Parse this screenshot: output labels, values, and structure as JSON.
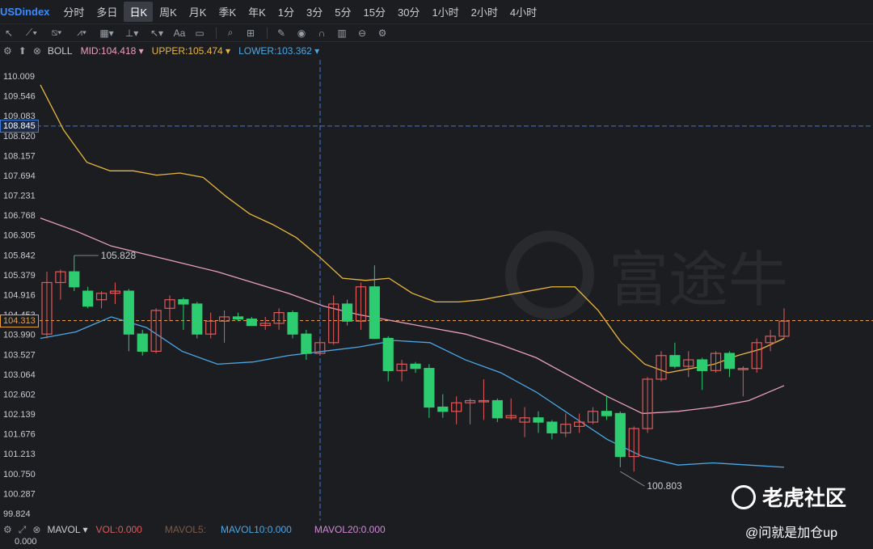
{
  "toolbar": {
    "symbol": "USDindex",
    "timeframes": [
      "分时",
      "多日",
      "日K",
      "周K",
      "月K",
      "季K",
      "年K",
      "1分",
      "3分",
      "5分",
      "15分",
      "30分",
      "1小时",
      "2小时",
      "4小时"
    ],
    "active_timeframe": "日K"
  },
  "drawing_tools": [
    "cursor-icon",
    "line-tool-icon",
    "channel-tool-icon",
    "pattern-tool-icon",
    "fib-tool-icon",
    "measure-tool-icon",
    "arrow-tool-icon",
    "text-tool-icon",
    "comment-icon",
    "zoom-icon",
    "magnet-icon",
    "pencil-icon",
    "eye-icon",
    "lock-icon",
    "trash-icon",
    "link-icon",
    "settings-icon"
  ],
  "indicator": {
    "name": "BOLL",
    "mid": "MID:104.418",
    "upper": "UPPER:105.474",
    "lower": "LOWER:103.362",
    "colors": {
      "mid": "#e8a0b8",
      "upper": "#e8b83c",
      "lower": "#4aa8e8"
    }
  },
  "price_axis": [
    "110.009",
    "109.546",
    "109.083",
    "108.620",
    "108.157",
    "107.694",
    "107.231",
    "106.768",
    "106.305",
    "105.842",
    "105.379",
    "104.916",
    "104.453",
    "103.990",
    "103.527",
    "103.064",
    "102.602",
    "102.139",
    "101.676",
    "101.213",
    "100.750",
    "100.287",
    "99.824"
  ],
  "crosshair_price": "108.845",
  "current_price": "104.313",
  "annotations": {
    "high": "105.828",
    "low": "100.803"
  },
  "volume": {
    "name": "MAVOL",
    "vol": "VOL:0.000",
    "mavol5": "MAVOL5:",
    "mavol10": "MAVOL10:0.000",
    "mavol20": "MAVOL20:0.000",
    "axis_zero": "0.000"
  },
  "watermark": {
    "brand": "富途牛",
    "community": "老虎社区",
    "author": "@问就是加仓up"
  },
  "colors": {
    "up": "#e05a5a",
    "down": "#2ecc71",
    "bg": "#1c1d21",
    "crosshair": "#3b7ad8",
    "current": "#e8a040"
  },
  "chart_data": {
    "type": "candlestick",
    "candles": [
      {
        "o": 104.0,
        "h": 105.45,
        "l": 103.9,
        "c": 105.2
      },
      {
        "o": 105.2,
        "h": 105.5,
        "l": 104.8,
        "c": 105.45
      },
      {
        "o": 105.45,
        "h": 105.83,
        "l": 105.0,
        "c": 105.1
      },
      {
        "o": 105.0,
        "h": 105.1,
        "l": 104.6,
        "c": 104.65
      },
      {
        "o": 104.8,
        "h": 105.0,
        "l": 104.6,
        "c": 104.95
      },
      {
        "o": 104.95,
        "h": 105.2,
        "l": 104.7,
        "c": 105.0
      },
      {
        "o": 105.0,
        "h": 105.05,
        "l": 103.6,
        "c": 104.0
      },
      {
        "o": 104.0,
        "h": 104.1,
        "l": 103.5,
        "c": 103.6
      },
      {
        "o": 103.6,
        "h": 104.6,
        "l": 103.55,
        "c": 104.55
      },
      {
        "o": 104.6,
        "h": 104.9,
        "l": 104.3,
        "c": 104.8
      },
      {
        "o": 104.8,
        "h": 104.85,
        "l": 104.1,
        "c": 104.7
      },
      {
        "o": 104.7,
        "h": 104.75,
        "l": 103.9,
        "c": 104.0
      },
      {
        "o": 104.0,
        "h": 104.5,
        "l": 103.9,
        "c": 104.3
      },
      {
        "o": 104.3,
        "h": 104.55,
        "l": 103.8,
        "c": 104.4
      },
      {
        "o": 104.4,
        "h": 104.5,
        "l": 104.3,
        "c": 104.35
      },
      {
        "o": 104.35,
        "h": 104.4,
        "l": 104.2,
        "c": 104.2
      },
      {
        "o": 104.2,
        "h": 104.4,
        "l": 104.1,
        "c": 104.25
      },
      {
        "o": 104.25,
        "h": 104.6,
        "l": 104.1,
        "c": 104.5
      },
      {
        "o": 104.5,
        "h": 104.55,
        "l": 103.9,
        "c": 104.0
      },
      {
        "o": 104.0,
        "h": 104.1,
        "l": 103.4,
        "c": 103.55
      },
      {
        "o": 103.55,
        "h": 103.9,
        "l": 103.5,
        "c": 103.8
      },
      {
        "o": 103.8,
        "h": 104.9,
        "l": 103.75,
        "c": 104.7
      },
      {
        "o": 104.7,
        "h": 104.8,
        "l": 104.2,
        "c": 104.3
      },
      {
        "o": 104.3,
        "h": 105.2,
        "l": 104.1,
        "c": 105.1
      },
      {
        "o": 105.1,
        "h": 105.6,
        "l": 103.9,
        "c": 103.9
      },
      {
        "o": 103.9,
        "h": 103.95,
        "l": 102.9,
        "c": 103.15
      },
      {
        "o": 103.15,
        "h": 103.4,
        "l": 102.9,
        "c": 103.3
      },
      {
        "o": 103.3,
        "h": 103.35,
        "l": 103.1,
        "c": 103.2
      },
      {
        "o": 103.2,
        "h": 103.3,
        "l": 102.05,
        "c": 102.3
      },
      {
        "o": 102.3,
        "h": 102.6,
        "l": 102.05,
        "c": 102.2
      },
      {
        "o": 102.2,
        "h": 102.55,
        "l": 101.9,
        "c": 102.4
      },
      {
        "o": 102.4,
        "h": 102.5,
        "l": 101.9,
        "c": 102.45
      },
      {
        "o": 102.45,
        "h": 102.95,
        "l": 102.0,
        "c": 102.45
      },
      {
        "o": 102.45,
        "h": 102.5,
        "l": 101.95,
        "c": 102.05
      },
      {
        "o": 102.05,
        "h": 102.5,
        "l": 102.0,
        "c": 102.1
      },
      {
        "o": 101.95,
        "h": 102.3,
        "l": 101.6,
        "c": 102.05
      },
      {
        "o": 102.05,
        "h": 102.2,
        "l": 101.7,
        "c": 101.95
      },
      {
        "o": 101.95,
        "h": 102.0,
        "l": 101.55,
        "c": 101.7
      },
      {
        "o": 101.7,
        "h": 102.15,
        "l": 101.6,
        "c": 101.9
      },
      {
        "o": 101.85,
        "h": 102.15,
        "l": 101.7,
        "c": 101.95
      },
      {
        "o": 101.95,
        "h": 102.3,
        "l": 101.9,
        "c": 102.2
      },
      {
        "o": 102.2,
        "h": 102.55,
        "l": 102.0,
        "c": 102.1
      },
      {
        "o": 102.15,
        "h": 102.2,
        "l": 100.9,
        "c": 101.15
      },
      {
        "o": 101.15,
        "h": 101.85,
        "l": 100.8,
        "c": 101.8
      },
      {
        "o": 101.8,
        "h": 103.0,
        "l": 101.7,
        "c": 102.95
      },
      {
        "o": 102.95,
        "h": 103.6,
        "l": 102.9,
        "c": 103.5
      },
      {
        "o": 103.5,
        "h": 103.8,
        "l": 103.2,
        "c": 103.25
      },
      {
        "o": 103.25,
        "h": 103.6,
        "l": 103.0,
        "c": 103.4
      },
      {
        "o": 103.4,
        "h": 103.45,
        "l": 102.7,
        "c": 103.15
      },
      {
        "o": 103.15,
        "h": 103.6,
        "l": 103.1,
        "c": 103.55
      },
      {
        "o": 103.55,
        "h": 103.6,
        "l": 103.0,
        "c": 103.2
      },
      {
        "o": 103.2,
        "h": 103.25,
        "l": 102.55,
        "c": 103.2
      },
      {
        "o": 103.2,
        "h": 103.9,
        "l": 103.1,
        "c": 103.8
      },
      {
        "o": 103.8,
        "h": 104.1,
        "l": 103.6,
        "c": 103.95
      },
      {
        "o": 103.95,
        "h": 104.6,
        "l": 103.9,
        "c": 104.3
      }
    ],
    "upper": [
      109.8,
      108.75,
      108.0,
      107.8,
      107.8,
      107.7,
      107.75,
      107.65,
      107.2,
      106.8,
      106.55,
      106.25,
      105.8,
      105.3,
      105.25,
      105.3,
      104.95,
      104.75,
      104.75,
      104.8,
      104.9,
      105.0,
      105.1,
      105.1,
      104.55,
      103.8,
      103.3,
      103.1,
      103.2,
      103.3,
      103.5,
      103.65,
      103.9
    ],
    "mid": [
      106.7,
      106.4,
      106.05,
      105.85,
      105.65,
      105.45,
      105.2,
      104.95,
      104.65,
      104.45,
      104.3,
      104.15,
      104.0,
      103.75,
      103.45,
      103.0,
      102.55,
      102.15,
      102.2,
      102.3,
      102.45,
      102.8
    ],
    "lower": [
      103.9,
      104.05,
      104.4,
      104.15,
      103.6,
      103.3,
      103.35,
      103.5,
      103.6,
      103.7,
      103.85,
      103.8,
      103.4,
      103.1,
      102.65,
      102.1,
      101.55,
      101.15,
      100.95,
      101.0,
      100.95,
      100.9
    ],
    "ylim": [
      99.824,
      110.009
    ]
  }
}
